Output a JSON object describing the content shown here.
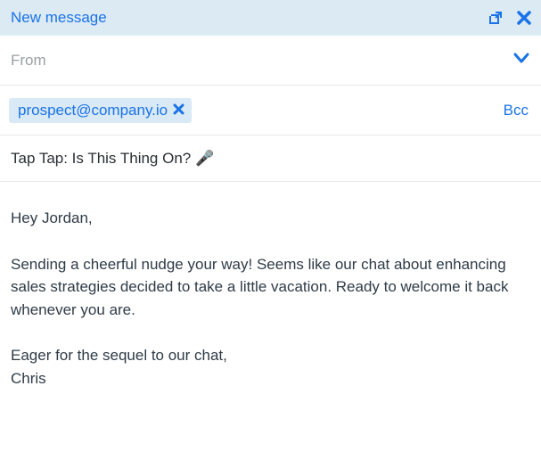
{
  "titlebar": {
    "title": "New message"
  },
  "from": {
    "label": "From"
  },
  "to": {
    "chip_email": "prospect@company.io",
    "bcc_label": "Bcc"
  },
  "subject": {
    "text": "Tap Tap: Is This Thing On? 🎤"
  },
  "body": {
    "greeting": "Hey Jordan,",
    "paragraph": "Sending a cheerful nudge your way! Seems like our chat about enhancing sales strategies decided to take a little vacation. Ready to welcome it back whenever you are.",
    "signoff": "Eager for the sequel to our chat,\nChris"
  }
}
